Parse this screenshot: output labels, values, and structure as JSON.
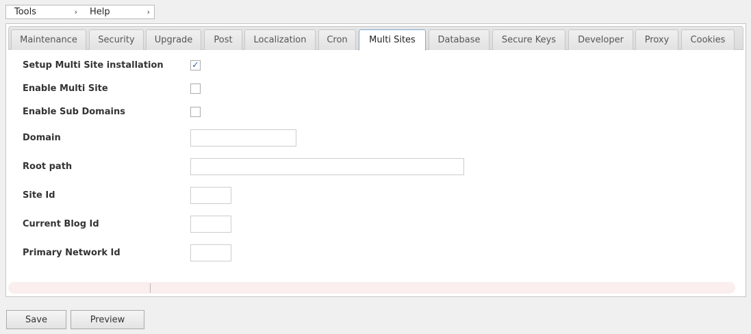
{
  "menubar": {
    "items": [
      {
        "label": "Tools",
        "chevron": "›"
      },
      {
        "label": "Help",
        "chevron": "›"
      }
    ]
  },
  "tabs": [
    {
      "label": "Maintenance"
    },
    {
      "label": "Security"
    },
    {
      "label": "Upgrade"
    },
    {
      "label": "Post"
    },
    {
      "label": "Localization"
    },
    {
      "label": "Cron"
    },
    {
      "label": "Multi Sites",
      "active": true
    },
    {
      "label": "Database"
    },
    {
      "label": "Secure Keys"
    },
    {
      "label": "Developer"
    },
    {
      "label": "Proxy"
    },
    {
      "label": "Cookies"
    }
  ],
  "form": {
    "setup_multisite": {
      "label": "Setup Multi Site installation",
      "checked": true,
      "check_glyph": "✓"
    },
    "enable_multisite": {
      "label": "Enable Multi Site",
      "checked": false
    },
    "enable_subdomains": {
      "label": "Enable Sub Domains",
      "checked": false
    },
    "domain": {
      "label": "Domain",
      "value": ""
    },
    "root_path": {
      "label": "Root path",
      "value": ""
    },
    "site_id": {
      "label": "Site Id",
      "value": ""
    },
    "current_blog_id": {
      "label": "Current Blog Id",
      "value": ""
    },
    "primary_network_id": {
      "label": "Primary Network Id",
      "value": ""
    }
  },
  "buttons": {
    "save": "Save",
    "preview": "Preview"
  },
  "colors": {
    "active_tab_border": "#7fa9d6",
    "checkmark": "#2d6bb4",
    "footer_strip": "#fbeeee"
  }
}
